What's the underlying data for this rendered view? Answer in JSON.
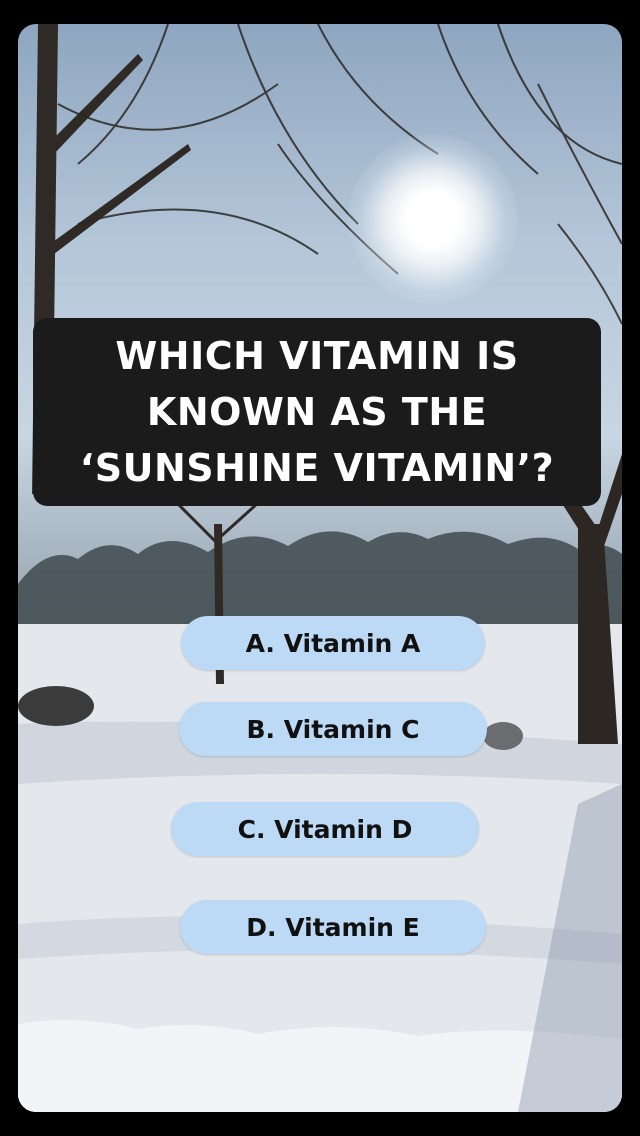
{
  "quiz": {
    "question": "WHICH VITAMIN IS\nKNOWN AS THE\n‘SUNSHINE VITAMIN’?",
    "answers": [
      {
        "label": "A. Vitamin A"
      },
      {
        "label": "B. Vitamin C"
      },
      {
        "label": "C. Vitamin D"
      },
      {
        "label": "D. Vitamin E"
      }
    ]
  },
  "colors": {
    "question_box": "#1b1b1b",
    "question_text": "#ffffff",
    "answer_bg": "#bcd9f5",
    "answer_text": "#111111"
  },
  "background": {
    "scene": "snowy park with bare trees and bright winter sun"
  }
}
